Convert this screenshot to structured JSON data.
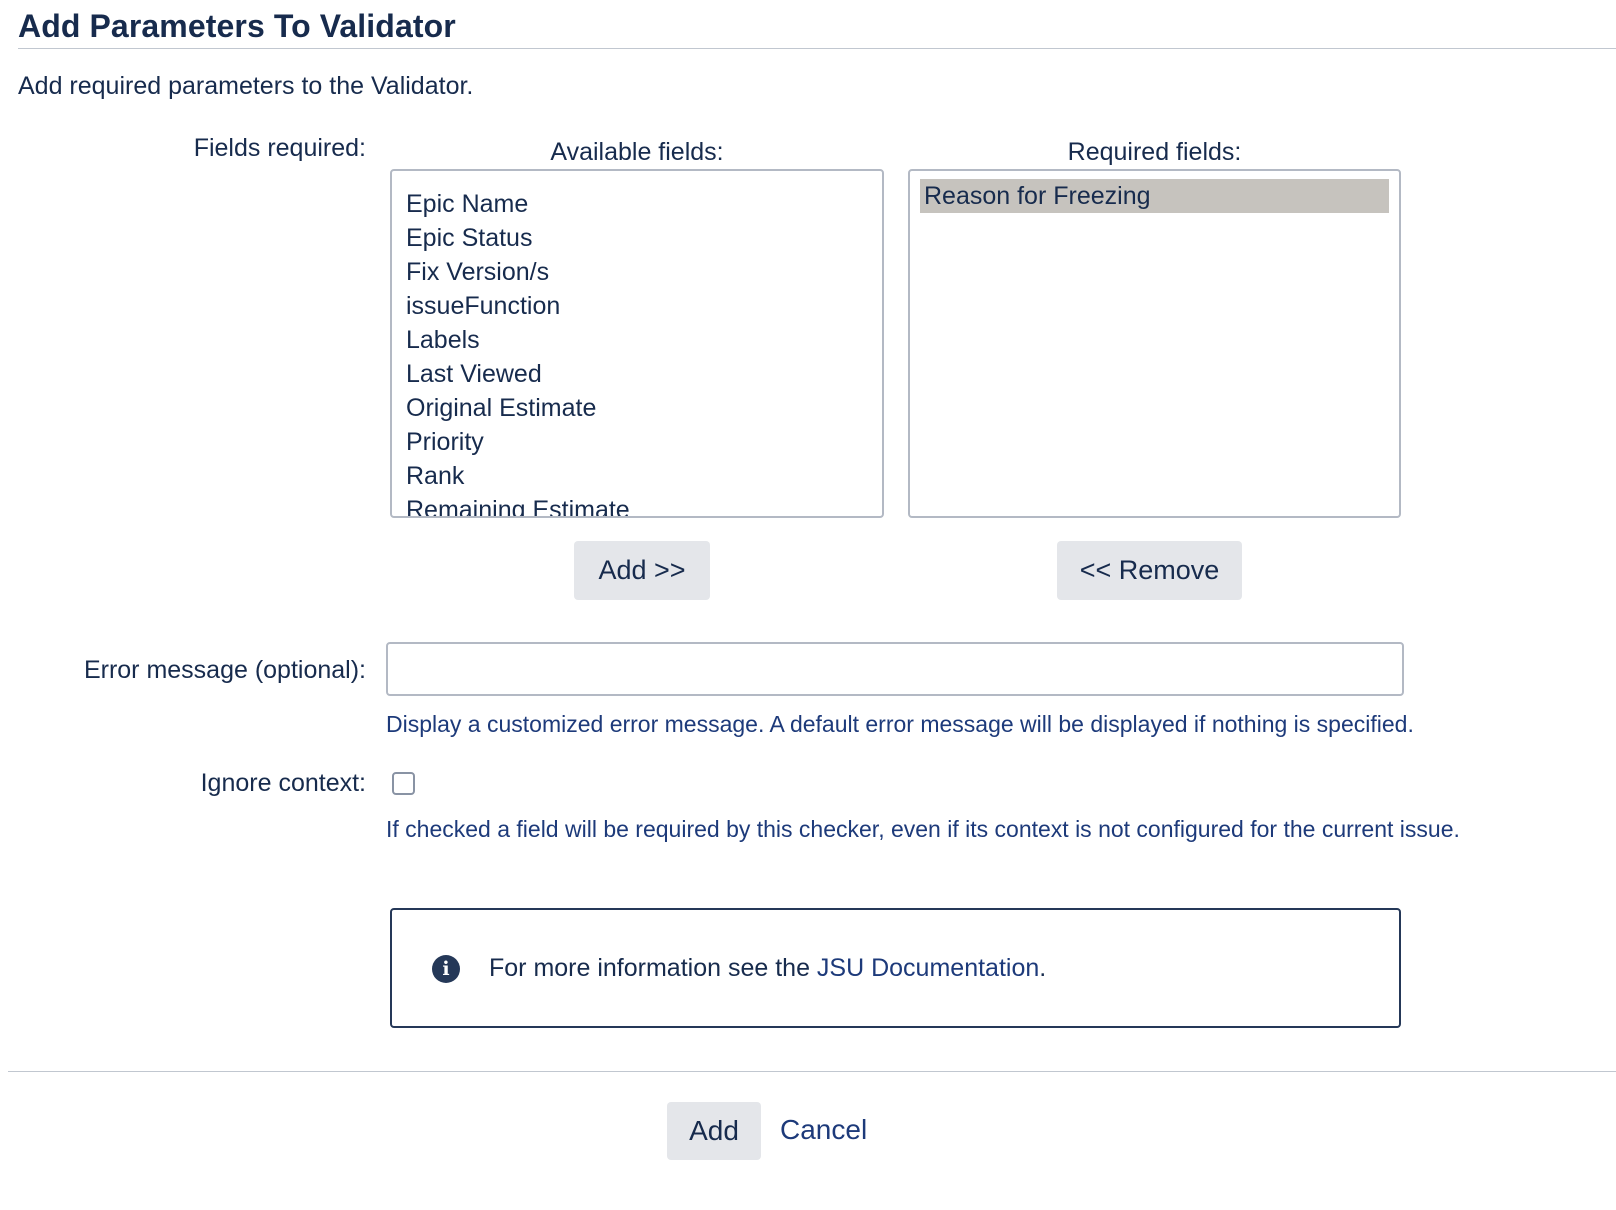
{
  "dialog": {
    "title": "Add Parameters To Validator",
    "description": "Add required parameters to the Validator."
  },
  "fields_required": {
    "label": "Fields required:",
    "available": {
      "heading": "Available fields:",
      "options": [
        "Epic Name",
        "Epic Status",
        "Fix Version/s",
        "issueFunction",
        "Labels",
        "Last Viewed",
        "Original Estimate",
        "Priority",
        "Rank",
        "Remaining Estimate"
      ],
      "add_label": "Add >>"
    },
    "required": {
      "heading": "Required fields:",
      "options": [
        "Reason for Freezing"
      ],
      "selected": "Reason for Freezing",
      "remove_label": "<< Remove"
    }
  },
  "error_message": {
    "label": "Error message (optional):",
    "value": "",
    "help": "Display a customized error message. A default error message will be displayed if nothing is specified."
  },
  "ignore_context": {
    "label": "Ignore context:",
    "checked": false,
    "help": "If checked a field will be required by this checker, even if its context is not configured for the current issue."
  },
  "info": {
    "icon": "info-icon",
    "text_before": "For more information see the ",
    "link_text": "JSU Documentation",
    "text_after": "."
  },
  "footer": {
    "submit_label": "Add",
    "cancel_label": "Cancel"
  },
  "colors": {
    "text": "#172b4d",
    "link": "#1d3a7a",
    "button_bg": "#e4e6ea",
    "selected_option_bg": "#c6c3be",
    "info_border": "#253858"
  }
}
